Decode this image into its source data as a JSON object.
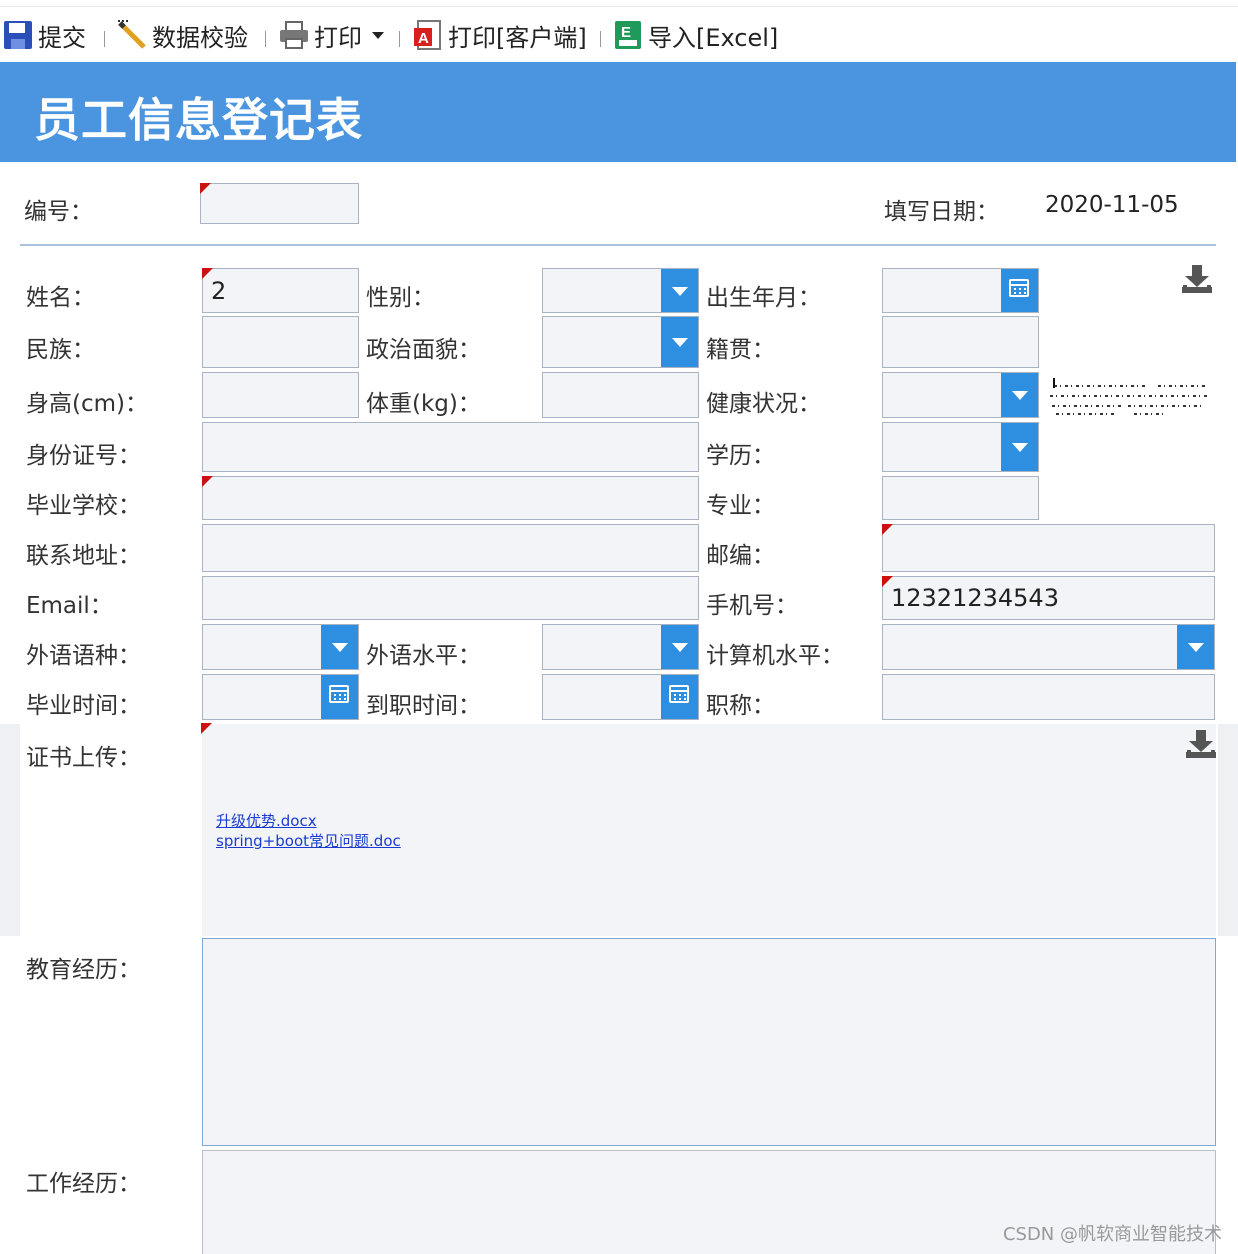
{
  "toolbar": {
    "submit": "提交",
    "validate": "数据校验",
    "print": "打印",
    "print_client": "打印[客户端]",
    "import_excel": "导入[Excel]"
  },
  "form_title": "员工信息登记表",
  "fields": {
    "number_label": "编号：",
    "fill_date_label": "填写日期：",
    "fill_date_value": "2020-11-05",
    "name_label": "姓名：",
    "name_value": "2",
    "gender_label": "性别：",
    "birth_label": "出生年月：",
    "ethnicity_label": "民族：",
    "politics_label": "政治面貌：",
    "native_label": "籍贯：",
    "height_label": "身高(cm)：",
    "weight_label": "体重(kg)：",
    "health_label": "健康状况：",
    "idcard_label": "身份证号：",
    "education_label": "学历：",
    "school_label": "毕业学校：",
    "major_label": "专业：",
    "address_label": "联系地址：",
    "postcode_label": "邮编：",
    "email_label": "Email：",
    "phone_label": "手机号：",
    "phone_value": "12321234543",
    "lang_type_label": "外语语种：",
    "lang_level_label": "外语水平：",
    "computer_level_label": "计算机水平：",
    "grad_time_label": "毕业时间：",
    "join_time_label": "到职时间：",
    "title_label": "职称：",
    "cert_label": "证书上传：",
    "edu_history_label": "教育经历：",
    "work_history_label": "工作经历："
  },
  "attachments": [
    "升级优势.docx",
    "spring+boot常见问题.doc"
  ],
  "watermark": "CSDN @帆软商业智能技术",
  "colors": {
    "header_bg": "#4a94e0",
    "button_blue": "#2e8ee0",
    "required_mark": "#cc1111",
    "link": "#1a3bd0"
  },
  "icons": [
    "save-icon",
    "validate-pencil-icon",
    "printer-icon",
    "chevron-down-icon",
    "pdf-print-icon",
    "excel-icon",
    "download-icon",
    "calendar-icon"
  ]
}
